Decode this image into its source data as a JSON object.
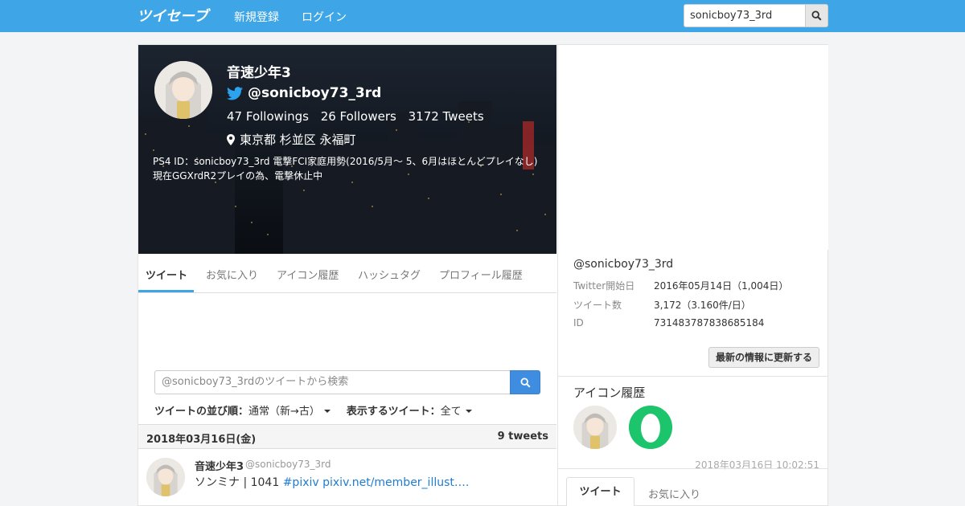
{
  "navbar": {
    "logo_text": "ツイセーブ",
    "register": "新規登録",
    "login": "ログイン",
    "search_value": "sonicboy73_3rd"
  },
  "profile": {
    "name": "音速少年3",
    "handle": "@sonicboy73_3rd",
    "followings": "47 Followings",
    "followers": "26 Followers",
    "tweets": "3172 Tweets",
    "location": "東京都 杉並区 永福町",
    "bio": "PS4 ID：sonicboy73_3rd 電撃FCI家庭用勢(2016/5月～ 5、6月はほとんどプレイなし) 現在GGXrdR2プレイの為、電撃休止中"
  },
  "tabs": [
    "ツイート",
    "お気に入り",
    "アイコン履歴",
    "ハッシュタグ",
    "プロフィール履歴"
  ],
  "tweet_search": {
    "placeholder": "@sonicboy73_3rdのツイートから検索"
  },
  "sort": {
    "order_label": "ツイートの並び順：",
    "order_value": "通常（新→古）",
    "show_label": "表示するツイート：",
    "show_value": "全て"
  },
  "datebar": {
    "date": "2018年03月16日(金)",
    "count": "9 tweets"
  },
  "tweet": {
    "name": "音速少年3",
    "handle": "@sonicboy73_3rd",
    "time": "2018年03月16日 10:02:51",
    "text": "ソンミナ | 1041 ",
    "link": "#pixiv pixiv.net/member_illust…."
  },
  "info": {
    "handle": "@sonicboy73_3rd",
    "rows": [
      {
        "label": "Twitter開始日",
        "value": "2016年05月14日（1,004日）"
      },
      {
        "label": "ツイート数",
        "value": "3,172（3.160件/日）"
      },
      {
        "label": "ID",
        "value": "731483787838685184"
      }
    ],
    "update_button": "最新の情報に更新する"
  },
  "icon_history": {
    "title": "アイコン履歴"
  },
  "right_tabs": {
    "active": "ツイート",
    "other": "お気に入り"
  },
  "colors": {
    "brand": "#3ea6e6",
    "link": "#1f7cd1",
    "search_button": "#3f8de0",
    "history_icon_green": "#1cc46b"
  }
}
